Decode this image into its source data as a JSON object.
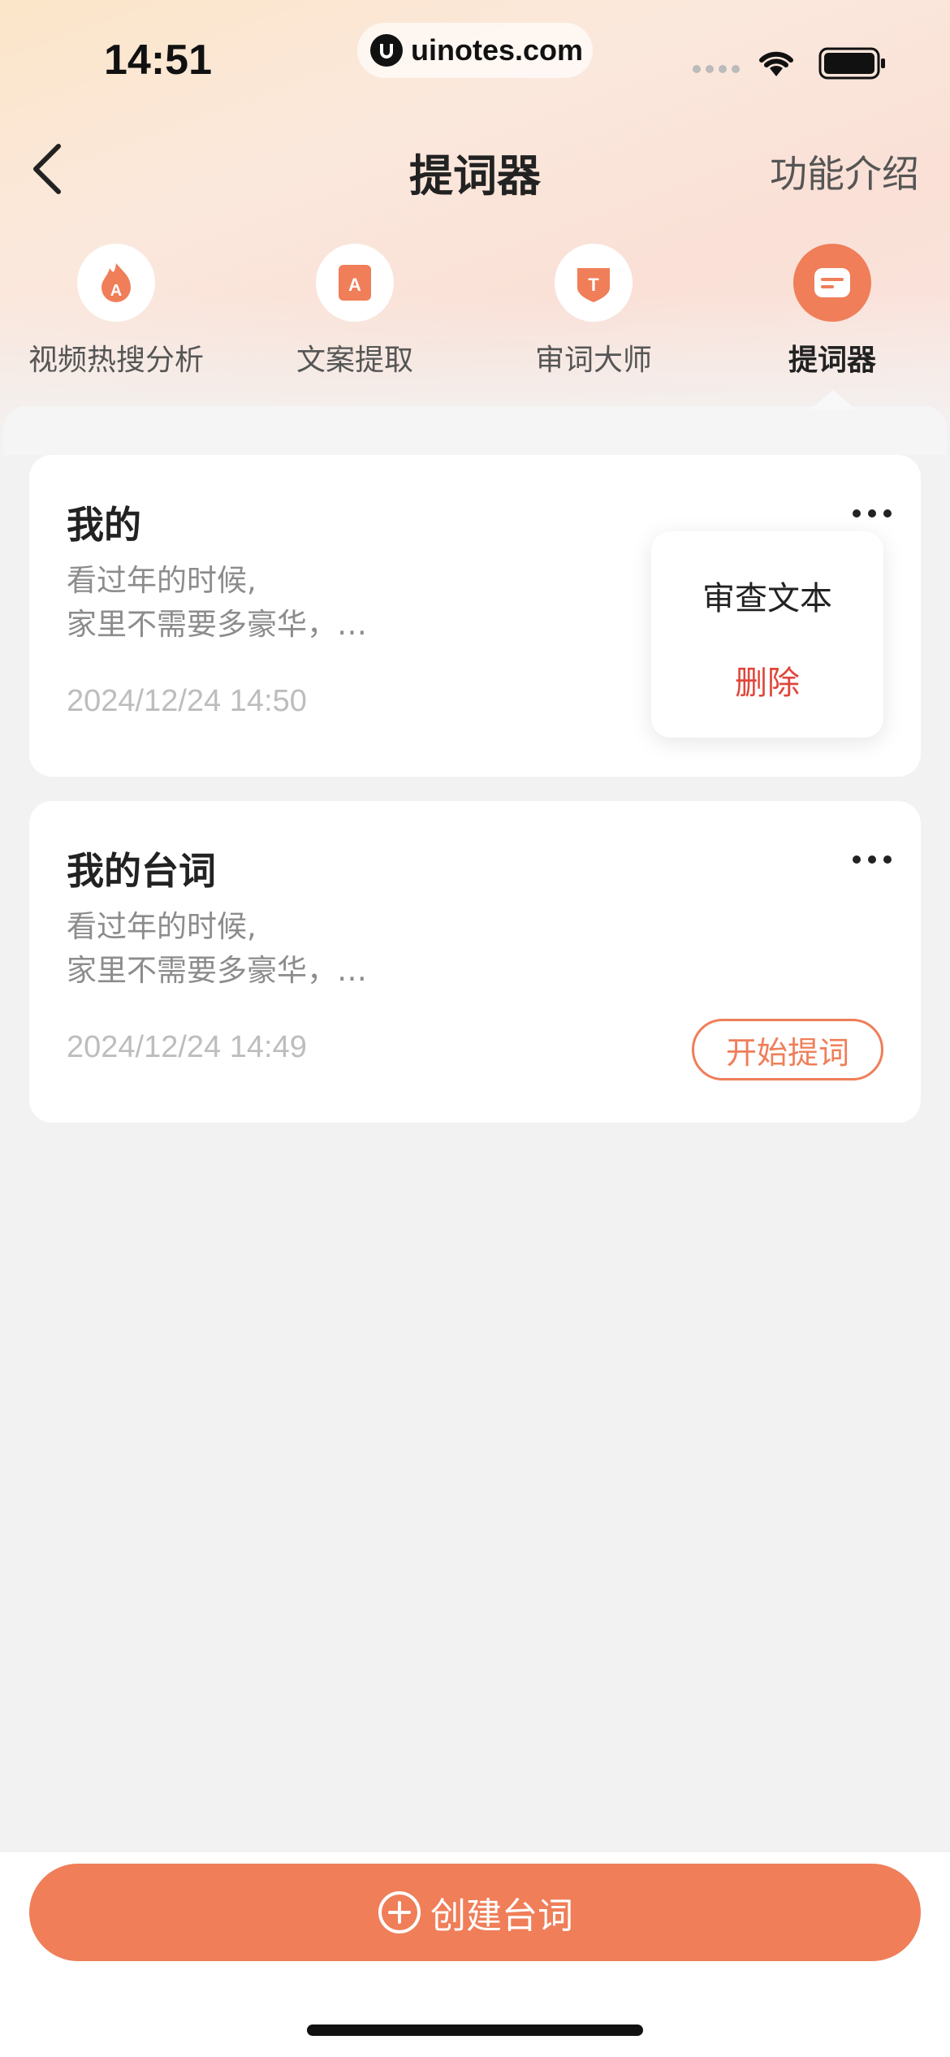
{
  "status_bar": {
    "time": "14:51",
    "url": "uinotes.com"
  },
  "nav": {
    "title": "提词器",
    "right_action": "功能介绍"
  },
  "tools": [
    {
      "label": "视频热搜分析",
      "icon": "flame-a-icon",
      "active": false
    },
    {
      "label": "文案提取",
      "icon": "copy-extract-icon",
      "active": false
    },
    {
      "label": "审词大师",
      "icon": "text-review-icon",
      "active": false
    },
    {
      "label": "提词器",
      "icon": "teleprompter-icon",
      "active": true
    }
  ],
  "scripts": [
    {
      "title": "我的",
      "preview_line1": "看过年的时候,",
      "preview_line2": "家里不需要多豪华，…",
      "date": "2024/12/24 14:50"
    },
    {
      "title": "我的台词",
      "preview_line1": "看过年的时候,",
      "preview_line2": "家里不需要多豪华，…",
      "date": "2024/12/24 14:49",
      "action": "开始提词"
    }
  ],
  "popup_menu": {
    "review": "审查文本",
    "delete": "删除"
  },
  "bottom": {
    "create_label": "创建台词"
  },
  "colors": {
    "accent": "#ef7e59",
    "danger": "#e0463b",
    "background": "#f2f2f2"
  }
}
